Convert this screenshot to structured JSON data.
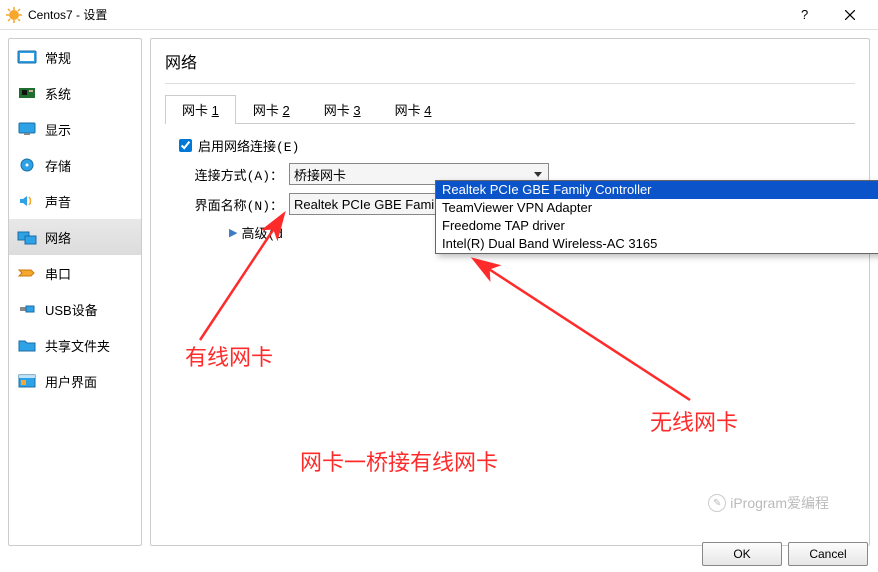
{
  "window": {
    "title": "Centos7 - 设置"
  },
  "sidebar": {
    "items": [
      {
        "label": "常规"
      },
      {
        "label": "系统"
      },
      {
        "label": "显示"
      },
      {
        "label": "存储"
      },
      {
        "label": "声音"
      },
      {
        "label": "网络"
      },
      {
        "label": "串口"
      },
      {
        "label": "USB设备"
      },
      {
        "label": "共享文件夹"
      },
      {
        "label": "用户界面"
      }
    ],
    "selected_index": 5
  },
  "main": {
    "heading": "网络",
    "tabs": [
      {
        "label_prefix": "网卡 ",
        "hotkey": "1"
      },
      {
        "label_prefix": "网卡 ",
        "hotkey": "2"
      },
      {
        "label_prefix": "网卡 ",
        "hotkey": "3"
      },
      {
        "label_prefix": "网卡 ",
        "hotkey": "4"
      }
    ],
    "active_tab": 0,
    "enable_label": "启用网络连接(E)",
    "enable_checked": true,
    "attach_label": "连接方式(A)：",
    "attach_value": "桥接网卡",
    "iface_label": "界面名称(N)：",
    "iface_value": "Realtek PCIe GBE Family Controller",
    "iface_options": [
      "Realtek PCIe GBE Family Controller",
      "TeamViewer VPN Adapter",
      "Freedome TAP driver",
      "Intel(R) Dual Band Wireless-AC 3165"
    ],
    "iface_highlight_index": 0,
    "advanced_label": "高级(d"
  },
  "buttons": {
    "ok": "OK",
    "cancel": "Cancel"
  },
  "annotations": {
    "wired": "有线网卡",
    "wireless": "无线网卡",
    "bridge": "网卡一桥接有线网卡"
  },
  "watermark": "iProgram爱编程"
}
